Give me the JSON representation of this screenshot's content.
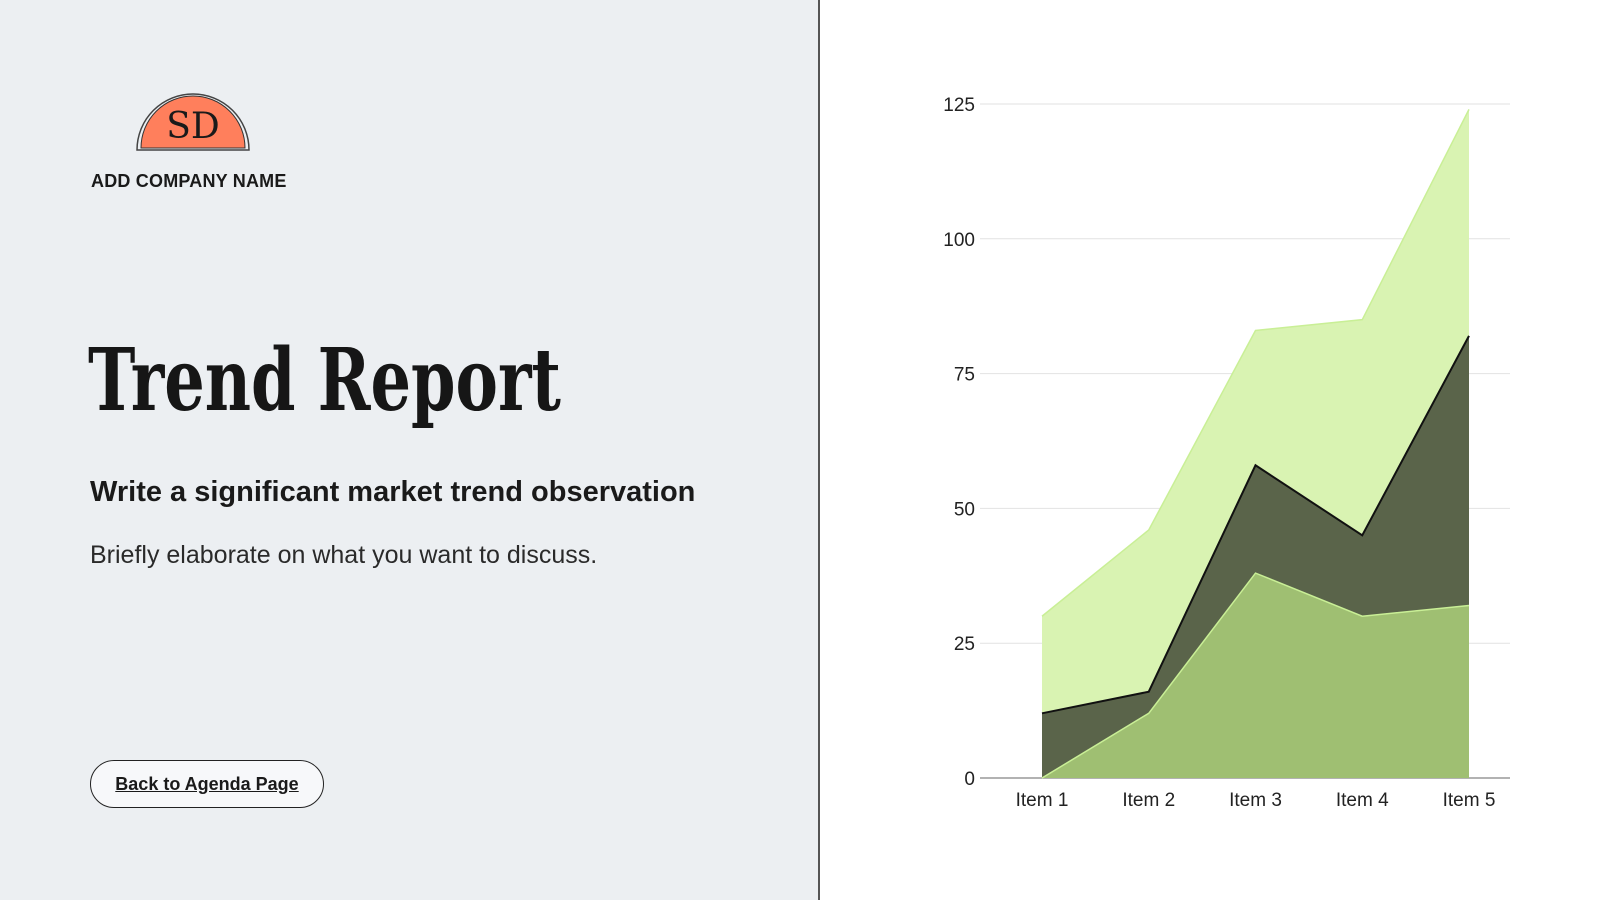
{
  "brand": {
    "logo_initials": "SD",
    "company_name": "ADD COMPANY NAME"
  },
  "slide": {
    "title": "Trend Report",
    "subtitle": "Write a significant market trend observation",
    "body": "Briefly elaborate on what you want to discuss.",
    "back_button_label": "Back to Agenda Page"
  },
  "colors": {
    "left_background": "#eceff2",
    "logo_fill": "#ff7f5c",
    "series_1": "#9fbf72",
    "series_2": "#5a644a",
    "series_3": "#d9f3b2"
  },
  "chart_data": {
    "type": "area",
    "stacked": true,
    "categories": [
      "Item 1",
      "Item 2",
      "Item 3",
      "Item 4",
      "Item 5"
    ],
    "series": [
      {
        "values": [
          0,
          12,
          38,
          30,
          32
        ]
      },
      {
        "values": [
          12,
          4,
          20,
          15,
          50
        ]
      },
      {
        "values": [
          18,
          30,
          25,
          40,
          42
        ]
      }
    ],
    "yticks": [
      0,
      25,
      50,
      75,
      100,
      125
    ],
    "ylim": [
      0,
      125
    ],
    "grid": true,
    "legend": "none"
  }
}
